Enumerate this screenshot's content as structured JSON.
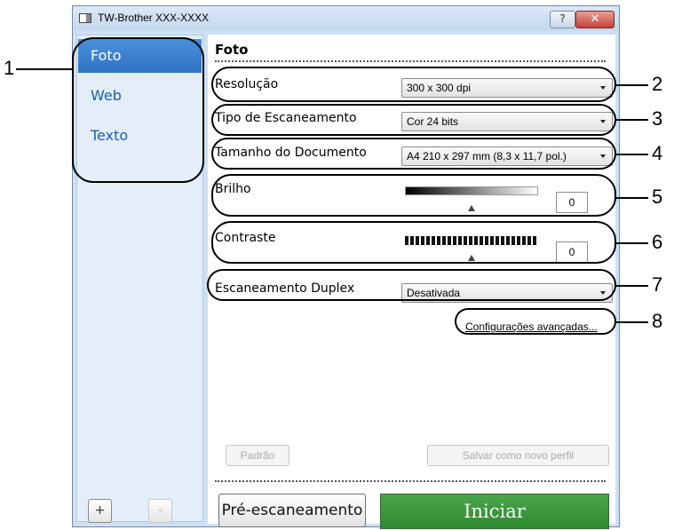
{
  "window": {
    "title": "TW-Brother XXX-XXXX",
    "help_label": "?",
    "close_label": "✕"
  },
  "sidebar": {
    "items": [
      {
        "label": "Foto",
        "selected": true
      },
      {
        "label": "Web",
        "selected": false
      },
      {
        "label": "Texto",
        "selected": false
      }
    ],
    "add_label": "+",
    "remove_label": "–"
  },
  "panel": {
    "title": "Foto",
    "resolution": {
      "label": "Resolução",
      "value": "300 x 300 dpi"
    },
    "scan_type": {
      "label": "Tipo de Escaneamento",
      "value": "Cor 24 bits"
    },
    "document_size": {
      "label": "Tamanho do Documento",
      "value": "A4 210 x 297 mm (8,3 x 11,7 pol.)"
    },
    "brightness": {
      "label": "Brilho",
      "value": "0"
    },
    "contrast": {
      "label": "Contraste",
      "value": "0"
    },
    "duplex": {
      "label": "Escaneamento Duplex",
      "value": "Desativada"
    },
    "advanced_link": "Configurações avançadas...",
    "default_button": "Padrão",
    "save_profile_button": "Salvar como novo perfil",
    "prescan_button": "Pré-escaneamento",
    "start_button": "Iniciar"
  },
  "callouts": [
    "1",
    "2",
    "3",
    "4",
    "5",
    "6",
    "7",
    "8"
  ],
  "colors": {
    "selected": "#2f72c4",
    "start_button": "#2f8a31",
    "link": "#1a5fb4"
  }
}
